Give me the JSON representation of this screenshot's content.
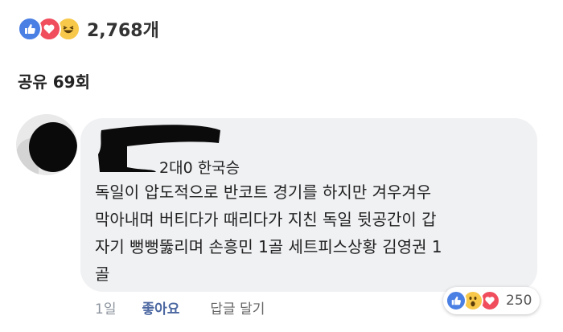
{
  "post_summary": {
    "reactions": [
      "like-icon",
      "love-icon",
      "haha-icon"
    ],
    "reaction_count": "2,768개",
    "share_count": "공유 69회"
  },
  "comment": {
    "author_suffix": "2대0 한국승",
    "text": "독일이 압도적으로 반코트 경기를 하지만 겨우겨우\n막아내며 버티다가 때리다가 지친 독일 뒷공간이 갑\n자기 뻥뻥뚫리며 손흥민 1골 세트피스상황 김영권 1\n골",
    "time": "1일",
    "like_label": "좋아요",
    "reply_label": "답글 달기",
    "reactions": [
      "like-icon",
      "wow-icon",
      "love-icon"
    ],
    "reaction_count": "250"
  },
  "colors": {
    "like": "#4a7fe4",
    "love": "#f04d5d",
    "haha": "#f7c84a",
    "bubble": "#f0f1f3",
    "link": "#4b67a1"
  }
}
